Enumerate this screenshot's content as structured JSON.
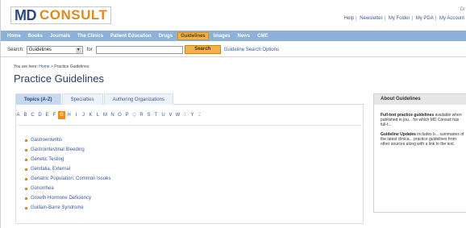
{
  "header": {
    "logo_md": "MD",
    "logo_consult": "CONSULT",
    "util_top": "Dr",
    "util_links": [
      "Help",
      "Newsletter",
      "My Folder",
      "My PDA",
      "My Account"
    ]
  },
  "nav": {
    "items": [
      {
        "label": "Home",
        "active": false
      },
      {
        "label": "Books",
        "active": false
      },
      {
        "label": "Journals",
        "active": false
      },
      {
        "label": "The Clinics",
        "active": false
      },
      {
        "label": "Patient Education",
        "active": false
      },
      {
        "label": "Drugs",
        "active": false
      },
      {
        "label": "Guidelines",
        "active": true
      },
      {
        "label": "Images",
        "active": false
      },
      {
        "label": "News",
        "active": false
      },
      {
        "label": "CME",
        "active": false
      }
    ]
  },
  "search": {
    "label": "Search:",
    "scope_value": "Guidelines",
    "for_label": "for",
    "query_value": "",
    "button_label": "Search",
    "options_link": "Guideline Search Options"
  },
  "breadcrumb": {
    "prefix": "You are here:",
    "home": "Home",
    "sep": ">",
    "current": "Practice Guidelines"
  },
  "page": {
    "title": "Practice Guidelines"
  },
  "tabs": [
    {
      "label": "Topics (A-Z)",
      "active": true
    },
    {
      "label": "Specialties",
      "active": false
    },
    {
      "label": "Authoring Organizations",
      "active": false
    }
  ],
  "alphabet": [
    {
      "letter": "A",
      "state": "normal"
    },
    {
      "letter": "B",
      "state": "normal"
    },
    {
      "letter": "C",
      "state": "normal"
    },
    {
      "letter": "D",
      "state": "normal"
    },
    {
      "letter": "E",
      "state": "normal"
    },
    {
      "letter": "F",
      "state": "normal"
    },
    {
      "letter": "G",
      "state": "active"
    },
    {
      "letter": "H",
      "state": "normal"
    },
    {
      "letter": "I",
      "state": "normal"
    },
    {
      "letter": "J",
      "state": "normal"
    },
    {
      "letter": "K",
      "state": "normal"
    },
    {
      "letter": "L",
      "state": "normal"
    },
    {
      "letter": "M",
      "state": "normal"
    },
    {
      "letter": "N",
      "state": "normal"
    },
    {
      "letter": "O",
      "state": "normal"
    },
    {
      "letter": "P",
      "state": "normal"
    },
    {
      "letter": "Q",
      "state": "dim"
    },
    {
      "letter": "R",
      "state": "normal"
    },
    {
      "letter": "S",
      "state": "normal"
    },
    {
      "letter": "T",
      "state": "normal"
    },
    {
      "letter": "U",
      "state": "normal"
    },
    {
      "letter": "V",
      "state": "normal"
    },
    {
      "letter": "W",
      "state": "normal"
    },
    {
      "letter": "X",
      "state": "dim"
    },
    {
      "letter": "Y",
      "state": "normal"
    },
    {
      "letter": "Z",
      "state": "dim"
    }
  ],
  "topics": [
    "Gastroenteritis",
    "Gastrointestinal Bleeding",
    "Genetic Testing",
    "Genitalia, External",
    "Geriatric Population: Common Issues",
    "Gonorrhea",
    "Growth Hormone Deficiency",
    "Guillain-Barre Syndrome"
  ],
  "sidebar": {
    "title": "About Guidelines",
    "para1_bold": "Full-text practice guidelines",
    "para1_text": "available when published in jou... for which MD Consult has full-t...",
    "para2_bold": "Guideline Updates",
    "para2_text": "includes b... summaries of the latest clinica... practice guidelines from other sources along with a link to the text."
  },
  "colors": {
    "nav_bg": "#8eb1d9",
    "accent_orange": "#f0b24a",
    "link_blue": "#3a5a9a",
    "title_navy": "#2a3d66"
  }
}
